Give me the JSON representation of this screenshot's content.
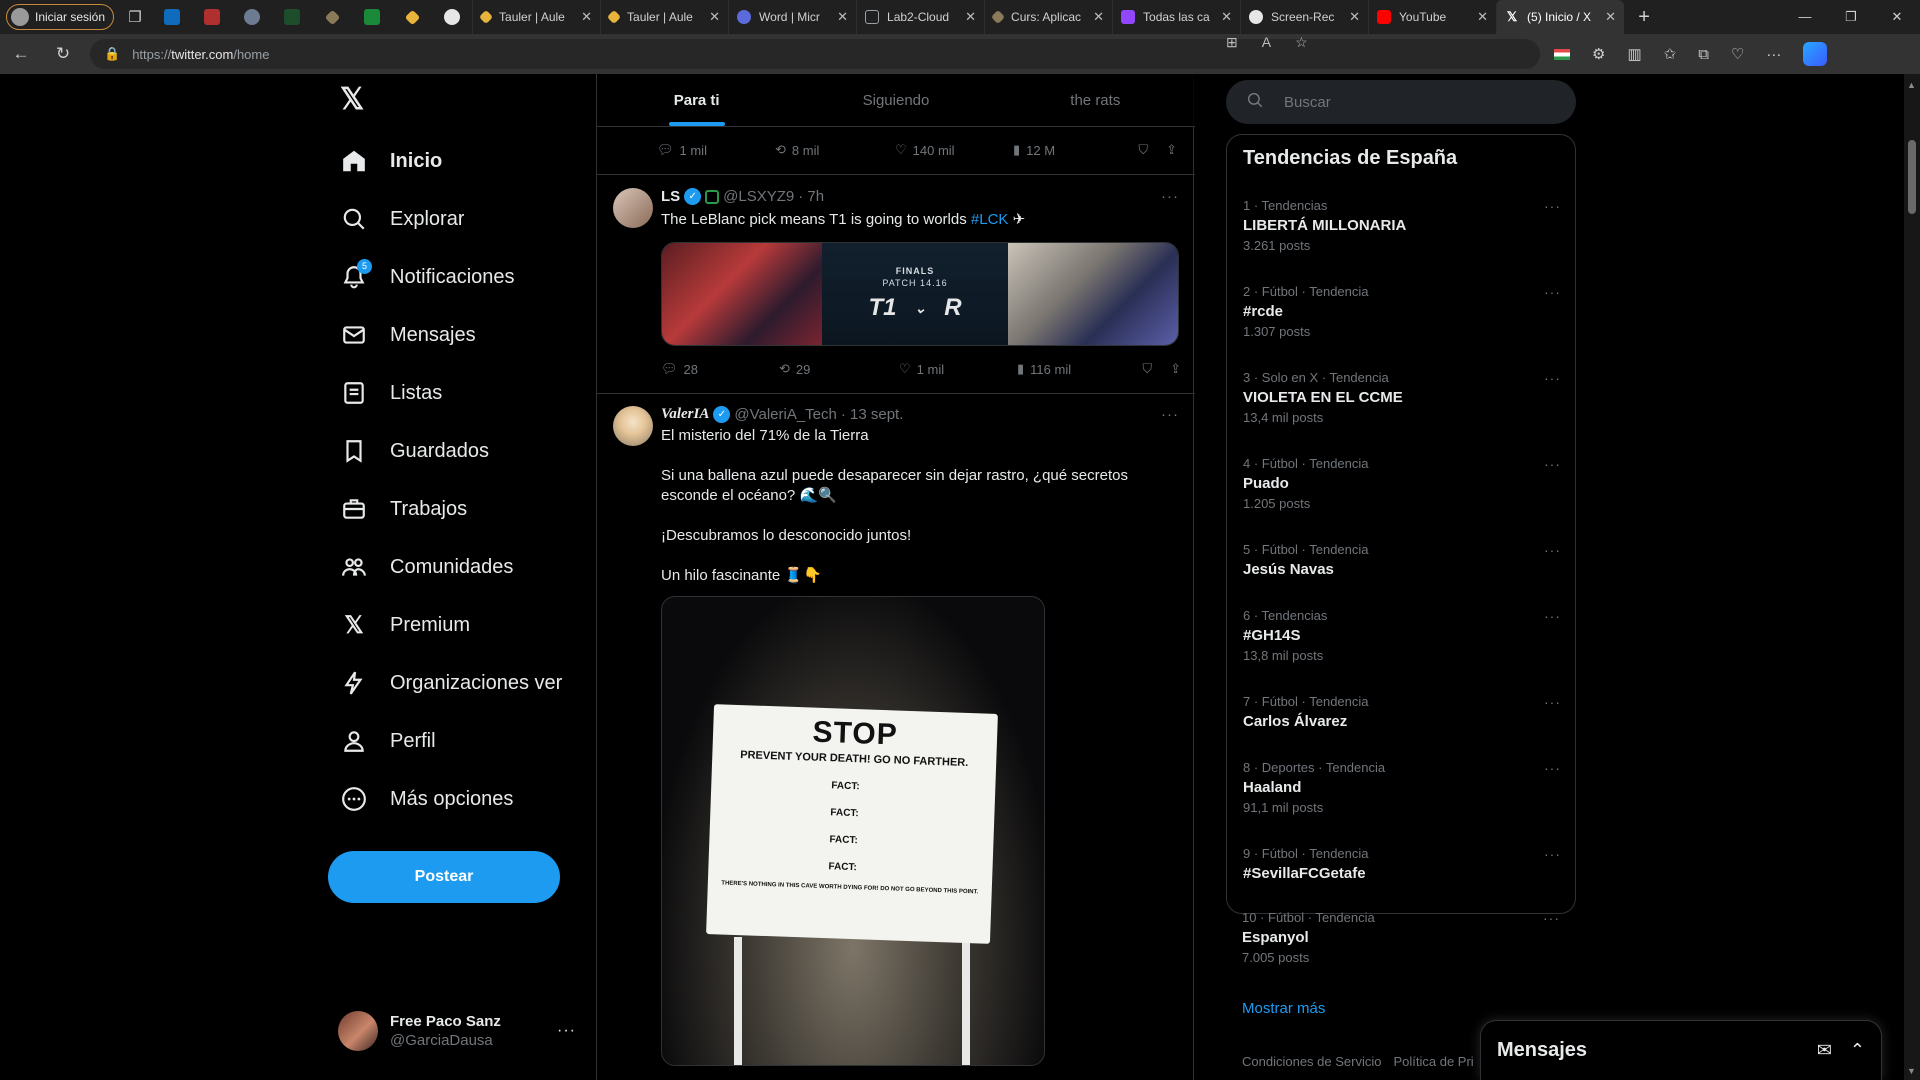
{
  "browser": {
    "profile_label": "Iniciar sesión",
    "tabs": [
      {
        "title": "Tauler | Aule",
        "color": "#e8b43c"
      },
      {
        "title": "Tauler | Aule",
        "color": "#e8b43c"
      },
      {
        "title": "Word | Micr",
        "color": "#5b6bdc"
      },
      {
        "title": "Lab2-Cloud",
        "color": "#9aa0a6"
      },
      {
        "title": "Curs: Aplicac",
        "color": "#8a7a5a"
      },
      {
        "title": "Todas las ca",
        "color": "#9146ff"
      },
      {
        "title": "Screen-Rec",
        "color": "#e6e6e6"
      },
      {
        "title": "YouTube",
        "color": "#ff0000"
      },
      {
        "title": "(5) Inicio / X",
        "color": "#000000"
      }
    ],
    "url_prefix": "https://",
    "url_host": "twitter.com",
    "url_path": "/home"
  },
  "nav": {
    "items": [
      {
        "label": "Inicio"
      },
      {
        "label": "Explorar"
      },
      {
        "label": "Notificaciones",
        "badge": "5"
      },
      {
        "label": "Mensajes"
      },
      {
        "label": "Listas"
      },
      {
        "label": "Guardados"
      },
      {
        "label": "Trabajos"
      },
      {
        "label": "Comunidades"
      },
      {
        "label": "Premium"
      },
      {
        "label": "Organizaciones ver"
      },
      {
        "label": "Perfil"
      },
      {
        "label": "Más opciones"
      }
    ],
    "post_button": "Postear",
    "user": {
      "name": "Free Paco Sanz",
      "handle": "@GarciaDausa"
    }
  },
  "timeline": {
    "tabs": [
      "Para ti",
      "Siguiendo",
      "the rats"
    ],
    "prev_actions": {
      "replies": "1 mil",
      "reposts": "8 mil",
      "likes": "140 mil",
      "views": "12 M"
    },
    "tweets": [
      {
        "name": "LS",
        "handle": "@LSXYZ9",
        "time": "· 7h",
        "text": "The LeBlanc pick means T1 is going to worlds",
        "hashtag": "#LCK",
        "image": {
          "title": "FINALS",
          "subtitle": "PATCH 14.16",
          "left_logo": "T1",
          "right_logo": "R"
        },
        "actions": {
          "replies": "28",
          "reposts": "29",
          "likes": "1 mil",
          "views": "116 mil"
        }
      },
      {
        "name": "ValerIA",
        "handle": "@ValeriA_Tech",
        "time": "· 13 sept.",
        "lines": [
          "El misterio del 71% de la Tierra",
          "Si una ballena azul puede desaparecer sin dejar rastro, ¿qué secretos esconde el océano? 🌊🔍",
          "¡Descubramos lo desconocido juntos!",
          "Un hilo fascinante 🧵👇"
        ],
        "sign": {
          "title": "STOP",
          "subtitle": "PREVENT YOUR DEATH! GO NO FARTHER.",
          "facts": [
            "FACT:",
            "FACT:",
            "FACT:",
            "FACT:"
          ],
          "footer": "THERE'S NOTHING IN THIS CAVE WORTH DYING FOR! DO NOT GO BEYOND THIS POINT."
        }
      }
    ]
  },
  "sidebar": {
    "search_placeholder": "Buscar",
    "trends_title": "Tendencias de España",
    "trends": [
      {
        "context": "1 · Tendencias",
        "name": "LIBERTÁ MILLONARIA",
        "posts": "3.261 posts"
      },
      {
        "context": "2 · Fútbol · Tendencia",
        "name": "#rcde",
        "posts": "1.307 posts"
      },
      {
        "context": "3 · Solo en X · Tendencia",
        "name": "VIOLETA EN EL CCME",
        "posts": "13,4 mil posts"
      },
      {
        "context": "4 · Fútbol · Tendencia",
        "name": "Puado",
        "posts": "1.205 posts"
      },
      {
        "context": "5 · Fútbol · Tendencia",
        "name": "Jesús Navas",
        "posts": ""
      },
      {
        "context": "6 · Tendencias",
        "name": "#GH14S",
        "posts": "13,8 mil posts"
      },
      {
        "context": "7 · Fútbol · Tendencia",
        "name": "Carlos Álvarez",
        "posts": ""
      },
      {
        "context": "8 · Deportes · Tendencia",
        "name": "Haaland",
        "posts": "91,1 mil posts"
      },
      {
        "context": "9 · Fútbol · Tendencia",
        "name": "#SevillaFCGetafe",
        "posts": ""
      },
      {
        "context": "10 · Fútbol · Tendencia",
        "name": "Espanyol",
        "posts": "7.005 posts"
      }
    ],
    "show_more": "Mostrar más",
    "footer_links": [
      "Condiciones de Servicio",
      "Política de Pri"
    ]
  },
  "messages": {
    "title": "Mensajes"
  }
}
